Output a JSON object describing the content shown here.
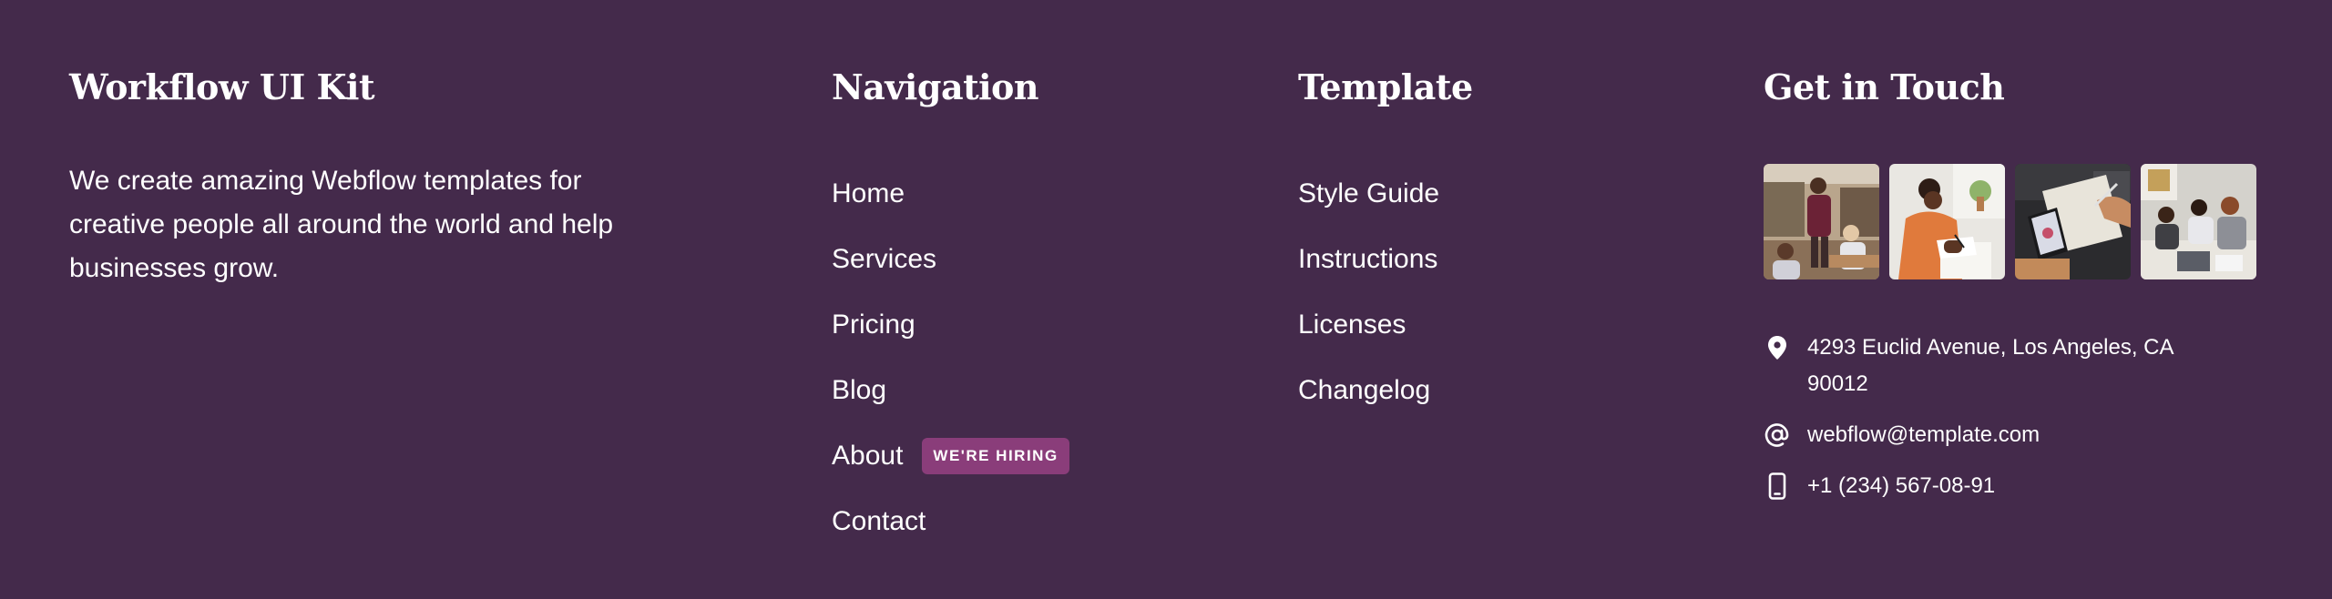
{
  "brand": {
    "title": "Workflow UI Kit",
    "description": "We create amazing Webflow templates for creative people all around the world and help businesses grow."
  },
  "navigation": {
    "heading": "Navigation",
    "items": [
      {
        "label": "Home"
      },
      {
        "label": "Services"
      },
      {
        "label": "Pricing"
      },
      {
        "label": "Blog"
      },
      {
        "label": "About",
        "badge": "WE'RE HIRING"
      },
      {
        "label": "Contact"
      }
    ]
  },
  "template": {
    "heading": "Template",
    "items": [
      {
        "label": "Style Guide"
      },
      {
        "label": "Instructions"
      },
      {
        "label": "Licenses"
      },
      {
        "label": "Changelog"
      }
    ]
  },
  "contact": {
    "heading": "Get in Touch",
    "address": "4293 Euclid Avenue, Los Angeles, CA 90012",
    "email": "webflow@template.com",
    "phone": "+1 (234) 567-08-91"
  },
  "colors": {
    "background": "#442a4b",
    "text": "#ffffff",
    "badge": "#8a3d7a"
  },
  "icons": {
    "address": "map-pin-icon",
    "email": "at-sign-icon",
    "phone": "smartphone-icon"
  }
}
